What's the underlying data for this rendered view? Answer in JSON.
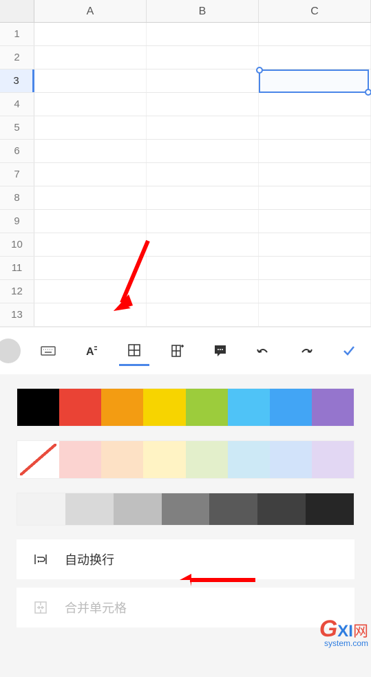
{
  "grid": {
    "columns": [
      "A",
      "B",
      "C"
    ],
    "rows": [
      "1",
      "2",
      "3",
      "4",
      "5",
      "6",
      "7",
      "8",
      "9",
      "10",
      "11",
      "12",
      "13"
    ],
    "selected_row": "3",
    "selected_cell": "C3"
  },
  "toolbar": {
    "keyboard": "keyboard-icon",
    "font": "font-format-icon",
    "cell": "cell-format-icon",
    "insert": "insert-icon",
    "comment": "comment-icon",
    "undo": "undo-icon",
    "redo": "redo-icon",
    "confirm": "confirm-icon"
  },
  "palette": {
    "fill_colors": [
      "#000000",
      "#ea4335",
      "#f39c12",
      "#f7d400",
      "#9ccc3c",
      "#4fc3f7",
      "#42a5f5",
      "#9575cd"
    ],
    "light_colors": [
      "no-fill",
      "#fbd3d0",
      "#fde1c5",
      "#fff3c4",
      "#e3efcb",
      "#cde9f6",
      "#d2e3fa",
      "#e2d7f3"
    ],
    "gray_colors": [
      "#f2f2f2",
      "#d9d9d9",
      "#bfbfbf",
      "#808080",
      "#595959",
      "#404040",
      "#262626"
    ]
  },
  "options": {
    "wrap_text": "自动换行",
    "merge_cells": "合并单元格"
  },
  "watermark": {
    "g": "G",
    "xi": "XI",
    "net": "网",
    "sub": "system.com"
  }
}
